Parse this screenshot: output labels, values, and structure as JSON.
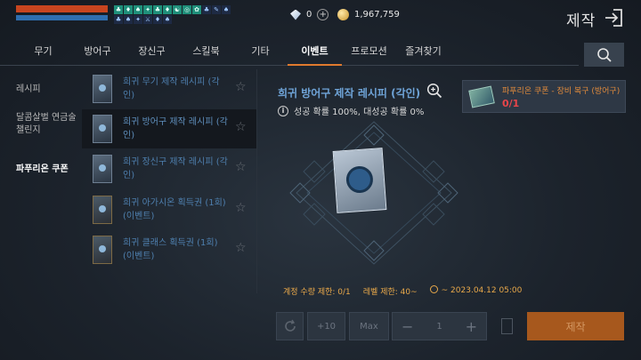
{
  "status": {
    "hp_fraction": 0.95,
    "mp_fraction": 0.95,
    "buff_icons": [
      "♣",
      "♦",
      "♠",
      "✦",
      "♣",
      "♦",
      "☯",
      "◎",
      "✿",
      "♣",
      "✎",
      "♠",
      "♣",
      "♠",
      "✦",
      "⚔",
      "♦",
      "♠"
    ],
    "diamonds": "0",
    "gold": "1,967,759"
  },
  "header": {
    "title": "제작"
  },
  "tabs": [
    {
      "label": "무기",
      "active": false
    },
    {
      "label": "방어구",
      "active": false
    },
    {
      "label": "장신구",
      "active": false
    },
    {
      "label": "스킬북",
      "active": false
    },
    {
      "label": "기타",
      "active": false
    },
    {
      "label": "이벤트",
      "active": true
    },
    {
      "label": "프로모션",
      "active": false
    },
    {
      "label": "즐겨찾기",
      "active": false
    }
  ],
  "categories": [
    {
      "label": "레시피"
    },
    {
      "label": "달콤살벌 연금술 챌린지"
    },
    {
      "label": "파푸리온 쿠폰"
    }
  ],
  "recipes": [
    {
      "name": "희귀 무기 제작 레시피 (각인)"
    },
    {
      "name": "희귀 방어구 제작 레시피 (각인)"
    },
    {
      "name": "희귀 장신구 제작 레시피 (각인)"
    },
    {
      "name": "희귀 아가시온 획득권 (1회) (이벤트)"
    },
    {
      "name": "희귀 클래스 획득권 (1회) (이벤트)"
    }
  ],
  "detail": {
    "title": "희귀 방어구 제작 레시피 (각인)",
    "info": "성공 확률 100%, 대성공 확률 0%",
    "material_name": "파푸리온 쿠폰 - 장비 복구 (방어구)",
    "material_count": "0/1",
    "limit_account": "계정 수량 제한: 0/1",
    "limit_level": "레벨 제한: 40~",
    "limit_date": "~ 2023.04.12 05:00"
  },
  "controls": {
    "plus10": "+10",
    "max": "Max",
    "minus": "−",
    "quantity": "1",
    "plus": "+",
    "craft": "제작"
  }
}
